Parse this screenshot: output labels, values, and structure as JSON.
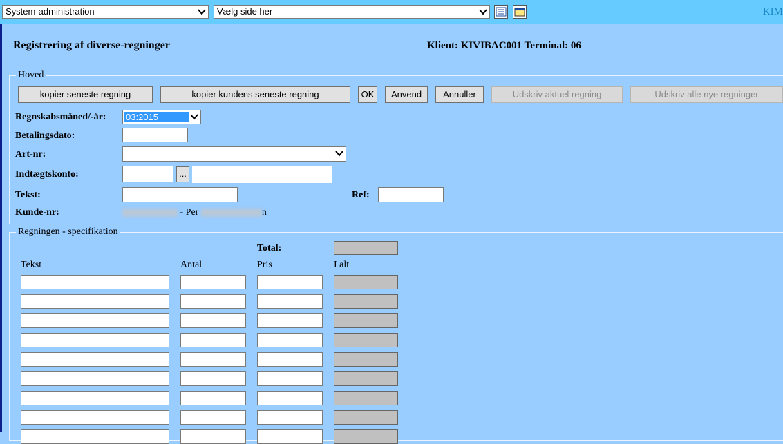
{
  "topbar": {
    "menu_select": "System-administration",
    "page_select": "Vælg side her",
    "brand": "KIM"
  },
  "header": {
    "title": "Registrering af diverse-regninger",
    "klient": "Klient: KIVIBAC001 Terminal: 06"
  },
  "hoved": {
    "legend": "Hoved",
    "buttons": {
      "copy_latest": "kopier seneste regning",
      "copy_customer_latest": "kopier kundens seneste regning",
      "ok": "OK",
      "apply": "Anvend",
      "cancel": "Annuller",
      "print_current": "Udskriv aktuel regning",
      "print_all_new": "Udskriv alle nye regninger"
    },
    "fields": {
      "period_label": "Regnskabsmåned/-år:",
      "period_value": "03:2015",
      "paydate_label": "Betalingsdato:",
      "art_label": "Art-nr:",
      "income_label": "Indtægtskonto:",
      "lookup": "...",
      "text_label": "Tekst:",
      "ref_label": "Ref:",
      "customer_label": "Kunde-nr:",
      "customer_mid": "- Per",
      "customer_end": "n"
    }
  },
  "spec": {
    "legend": "Regningen - specifikation",
    "total_label": "Total:",
    "columns": [
      "Tekst",
      "Antal",
      "Pris",
      "I alt"
    ]
  },
  "colors": {
    "background": "#99ccff",
    "topbar": "#66ccff",
    "selected": "#3399ff"
  }
}
